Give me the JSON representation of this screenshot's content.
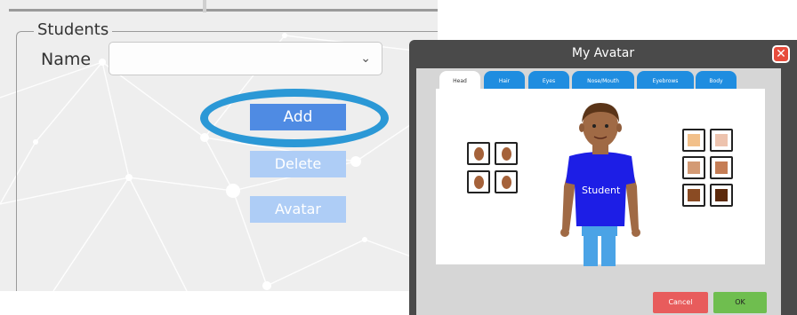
{
  "students_panel": {
    "legend": "Students",
    "name_label": "Name",
    "name_value": "",
    "buttons": {
      "add": "Add",
      "delete": "Delete",
      "avatar": "Avatar"
    }
  },
  "avatar_dialog": {
    "title": "My Avatar",
    "tabs": [
      "Head",
      "Hair",
      "Eyes",
      "Nose/Mouth",
      "Eyebrows",
      "Body"
    ],
    "active_tab": "Head",
    "shirt_text": "Student",
    "skin_tones": [
      "#f2c08a",
      "#edc3ae",
      "#d39a74",
      "#c57d55",
      "#8a4b23",
      "#5d2a0c"
    ],
    "cancel_label": "Cancel",
    "ok_label": "OK"
  },
  "colors": {
    "add_button": "#4f8be3",
    "disabled_button": "#aecdf6",
    "highlight_ring": "#2b98d6",
    "tab_blue": "#1f8de0",
    "shirt_blue": "#1d1ee6"
  }
}
